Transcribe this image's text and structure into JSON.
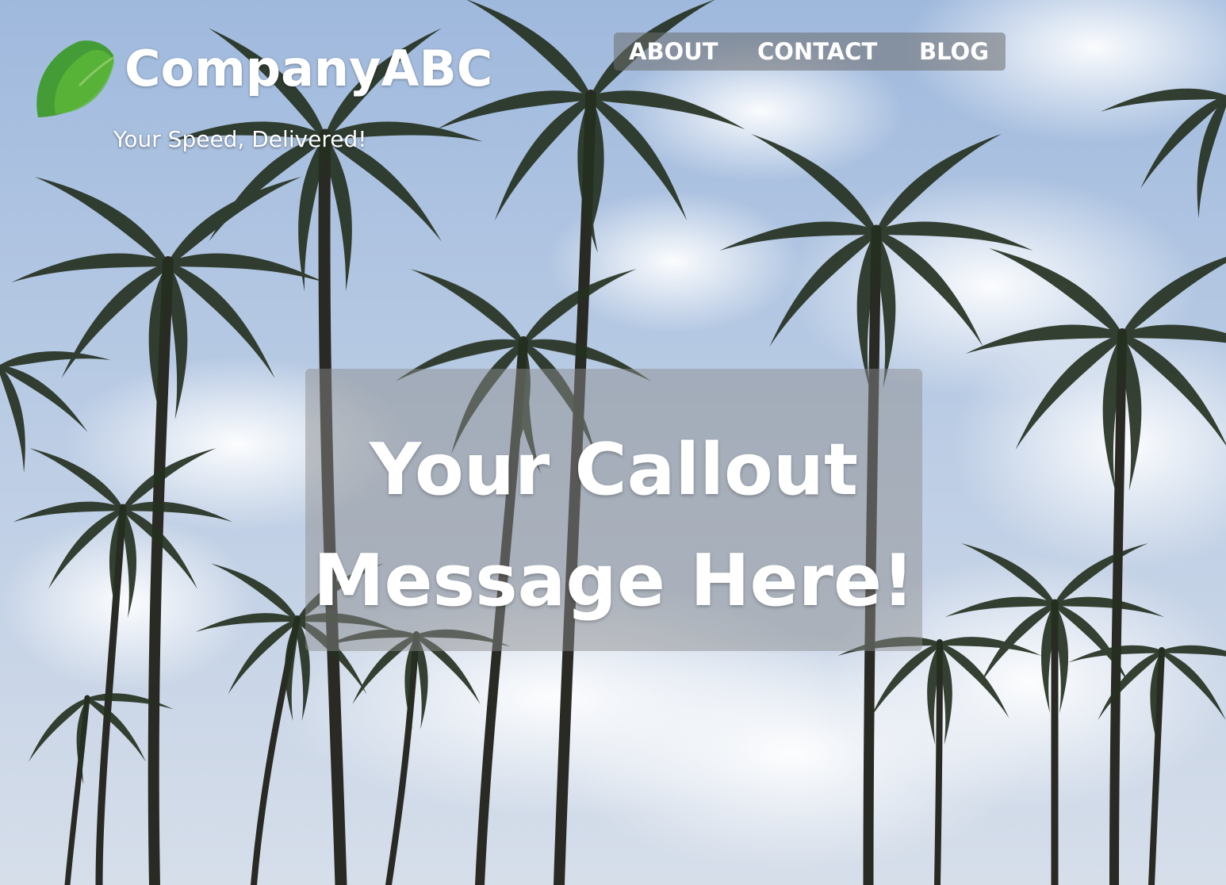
{
  "brand": {
    "name": "CompanyABC",
    "tagline": "Your Speed, Delivered!",
    "logo_color": "#3f9a2c"
  },
  "nav": {
    "items": [
      {
        "label": "ABOUT"
      },
      {
        "label": "CONTACT"
      },
      {
        "label": "BLOG"
      }
    ]
  },
  "hero": {
    "background": "palm-trees-sky-photo",
    "callout_line1": "Your Callout",
    "callout_line2": "Message Here!"
  },
  "colors": {
    "sky_top": "#8fb0dc",
    "sky_bottom": "#c4d3e6",
    "palm_dark": "#1f2a1c",
    "text": "#ffffff"
  }
}
